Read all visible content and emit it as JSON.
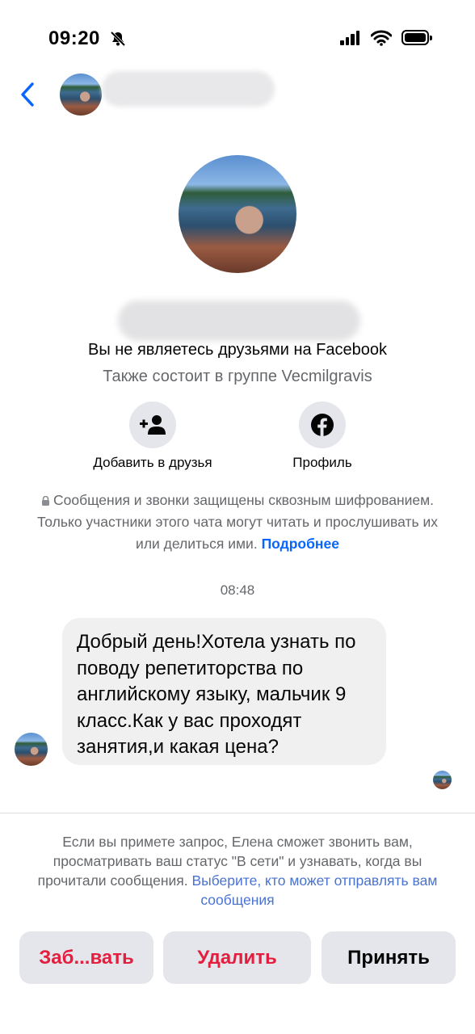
{
  "status_bar": {
    "time": "09:20",
    "icons": [
      "mute-bell-icon",
      "cellular-signal-icon",
      "wifi-icon",
      "battery-icon"
    ]
  },
  "header": {
    "back_icon": "chevron-left-icon",
    "accent_color": "#0866ff"
  },
  "profile": {
    "relation_text": "Вы не являетесь друзьями на Facebook",
    "group_text": "Также состоит в группе Vecmilgravis"
  },
  "actions": {
    "add_friend_label": "Добавить в друзья",
    "add_friend_icon": "add-person-icon",
    "profile_label": "Профиль",
    "profile_icon": "facebook-logo-icon"
  },
  "encryption": {
    "text": "Сообщения и звонки защищены сквозным шифрованием. Только участники этого чата могут читать и прослушивать их или делиться ими.",
    "link": "Подробнее"
  },
  "conversation": {
    "timestamp": "08:48",
    "message": "Добрый день!Хотела узнать по поводу репетиторства по английскому языку, мальчик 9 класс.Как у вас проходят занятия,и какая цена?"
  },
  "request_notice": {
    "text": "Если вы примете запрос, Елена сможет звонить вам, просматривать ваш статус \"В сети\" и узнавать, когда вы прочитали сообщения.",
    "link": "Выберите, кто может отправлять вам сообщения"
  },
  "buttons": {
    "block_label": "Заб...вать",
    "delete_label": "Удалить",
    "accept_label": "Принять",
    "danger_color": "#e41e3f"
  }
}
